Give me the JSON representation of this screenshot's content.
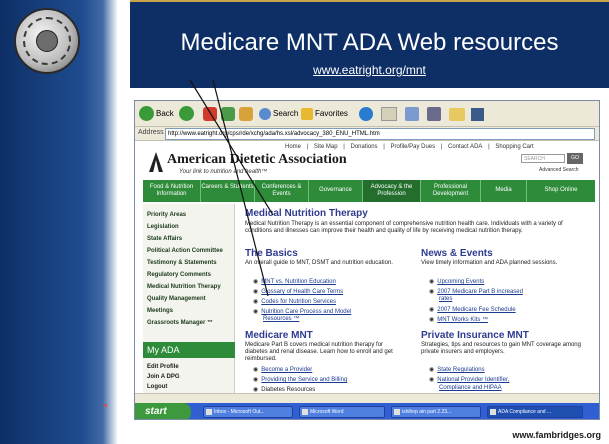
{
  "slide": {
    "title": "Medicare MNT ADA Web resources",
    "url": "www.eatright.org/mnt",
    "footer": "www.fambridges.org"
  },
  "browser": {
    "back_label": "Back",
    "search_label": "Search",
    "favorites_label": "Favorites",
    "address_label": "Address",
    "address_value": "http://www.eatright.org/cps/rde/xchg/ada/hs.xsl/advocacy_380_ENU_HTML.htm"
  },
  "site": {
    "top_links": [
      "Home",
      "|",
      "Site Map",
      "|",
      "Donations",
      "|",
      "Profile/Pay Dues",
      "|",
      "Contact ADA",
      "|",
      "Shopping Cart"
    ],
    "org_name": "American Dietetic Association",
    "tagline": "Your link to nutrition and health™",
    "search_placeholder": "SEARCH",
    "go_label": "GO",
    "advanced_search": "Advanced Search",
    "nav": [
      "Food & Nutrition Information",
      "Careers & Students",
      "Conferences & Events",
      "Governance",
      "Advocacy & the Profession",
      "Professional Development",
      "Media",
      "Shop Online"
    ],
    "sidebar": [
      "Priority Areas",
      "Legislation",
      "State Affairs",
      "Political Action Committee",
      "Testimony & Statements",
      "Regulatory Comments",
      "Medical Nutrition Therapy",
      "Quality Management",
      "Meetings",
      "Grassroots Manager ™"
    ],
    "my_ada": "My ADA",
    "my_ada_items": [
      "Edit Profile",
      "Join A DPG",
      "Logout"
    ]
  },
  "content": {
    "mnt_head": "Medical Nutrition Therapy",
    "mnt_text": "Medical Nutrition Therapy is an essential component of comprehensive nutrition health care. Individuals with a variety of conditions and illnesses can improve their health and quality of life by receiving medical nutrition therapy.",
    "basics_head": "The Basics",
    "basics_text": "An overall guide to MNT, DSMT and nutrition education.",
    "basics_links": [
      "MNT vs. Nutrition Education",
      "Glossary of Health Care Terms",
      "Codes for Nutrition Services",
      "Nutrition Care Process and Model",
      "Resources ™"
    ],
    "news_head": "News & Events",
    "news_text": "View timely information and ADA planned sessions.",
    "news_links": [
      "Upcoming Events",
      "2007 Medicare Part B increased",
      "rates",
      "2007 Medicare Fee Schedule",
      "MNT Works Kits ™"
    ],
    "medicare_head": "Medicare MNT",
    "medicare_text": "Medicare Part B covers medical nutrition therapy for diabetes and renal disease. Learn how to enroll and get reimbursed.",
    "medicare_links": [
      "Become a Provider",
      "Providing the Service and Billing",
      "Diabetes Resources"
    ],
    "private_head": "Private Insurance MNT",
    "private_text": "Strategies, tips and resources to gain MNT coverage among private insurers and employers.",
    "private_links": [
      "State Regulations",
      "National Provider Identifier,",
      "Compliance and HIPAA"
    ]
  },
  "taskbar": {
    "start": "start",
    "tasks": [
      "Inbox - Microsoft Out...",
      "Microsoft Word",
      "ishihep ain part 2.23...",
      "ADA Compliance and ..."
    ]
  },
  "colors": {
    "slide_blue": "#0e2f66",
    "ada_green": "#2e8b3a",
    "heading_blue": "#2f3b8f"
  }
}
